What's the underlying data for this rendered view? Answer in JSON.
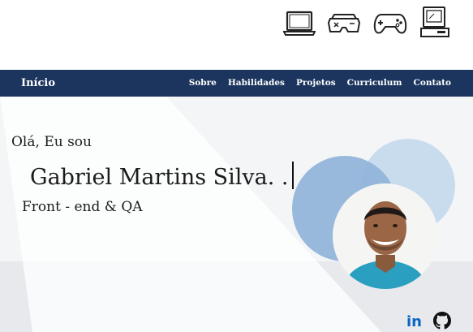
{
  "top_icons": [
    {
      "name": "laptop-icon"
    },
    {
      "name": "vr-headset-icon"
    },
    {
      "name": "gamepad-icon"
    },
    {
      "name": "desktop-computer-icon"
    }
  ],
  "nav": {
    "home": "Início",
    "links": [
      "Sobre",
      "Habilidades",
      "Projetos",
      "Curriculum",
      "Contato"
    ]
  },
  "hero": {
    "greeting": "Olá,  Eu sou",
    "name": "Gabriel Martins Silva. .",
    "role": "Front - end  &  QA"
  },
  "social": [
    {
      "icon": "linkedin-icon",
      "text": "in"
    },
    {
      "icon": "github-icon"
    }
  ],
  "colors": {
    "navbar": "#1c355e",
    "circle_dark": "#8fb3d8",
    "circle_light": "#c9dcee",
    "linkedin": "#0a66c2"
  }
}
